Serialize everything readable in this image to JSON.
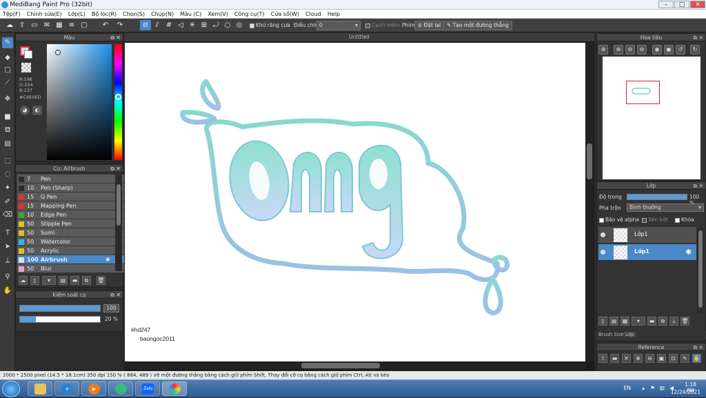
{
  "window": {
    "title": "MediBang Paint Pro (32bit)",
    "controls": [
      "–",
      "□",
      "✕"
    ]
  },
  "menu": [
    "Tệp(F)",
    "Chỉnh sửa(E)",
    "Lớp(L)",
    "Bộ lọc(R)",
    "Chọn(S)",
    "Chụp(N)",
    "Màu (C)",
    "Xem(V)",
    "Công cụ(T)",
    "Cửa sổ(W)",
    "Cloud",
    "Help"
  ],
  "toolbar": {
    "antialias_label": "Khử răng cưa",
    "adjust_label": "Điều chỉnh",
    "adjust_value": "0",
    "edge_label": "Cạnh mềm",
    "key_label": "Phím",
    "reset_label": "Đặt lại",
    "straight_line_label": "Tạo một đường thẳng"
  },
  "color_panel": {
    "title": "Màu",
    "r": "R:196",
    "g": "G:224",
    "b": "B:237",
    "hex": "#C4E0ED",
    "primary_color": "#C4E0ED"
  },
  "brush_panel": {
    "title": "Cọ: Airbrush",
    "brushes": [
      {
        "size": "7",
        "name": "Pen",
        "color": "#2a2a2a"
      },
      {
        "size": "10",
        "name": "Pen (Sharp)",
        "color": "#2a2a2a"
      },
      {
        "size": "15",
        "name": "G Pen",
        "color": "#e03030"
      },
      {
        "size": "15",
        "name": "Mapping Pen",
        "color": "#e03030"
      },
      {
        "size": "10",
        "name": "Edge Pen",
        "color": "#33aa33"
      },
      {
        "size": "50",
        "name": "Stipple Pen",
        "color": "#e0c020"
      },
      {
        "size": "50",
        "name": "Sumi",
        "color": "#e0c020"
      },
      {
        "size": "50",
        "name": "Watercolor",
        "color": "#30b8e8"
      },
      {
        "size": "50",
        "name": "Acrylic",
        "color": "#e0c020"
      },
      {
        "size": "100",
        "name": "Airbrush",
        "color": "#e0e0e0"
      },
      {
        "size": "50",
        "name": "Blur",
        "color": "#f0a0d0"
      }
    ],
    "selected_index": 9
  },
  "brush_control": {
    "title": "Kiểm soát cọ",
    "size_value": "100",
    "opacity_value": "20 %",
    "size_fraction": 1.0,
    "opacity_fraction": 0.2
  },
  "canvas": {
    "tab_title": "Untitled",
    "signature_line1": "#hd247",
    "signature_line2": "baongoc2011",
    "artwork_text": "omg"
  },
  "navigator": {
    "title": "Hoa tiêu"
  },
  "layer_panel": {
    "title": "Lớp",
    "opacity_label": "Độ trong",
    "opacity_value": "100 %",
    "opacity_fraction": 1.0,
    "blend_label": "Pha trộn",
    "blend_value": "Bình thường",
    "protect_alpha": "Bảo vệ alpha",
    "clipping": "Xén bớt",
    "lock": "Khóa",
    "layers": [
      {
        "name": "Lớp1"
      },
      {
        "name": "Lớp1"
      }
    ]
  },
  "bottom_tabs": [
    "Brush Size",
    "Lớp"
  ],
  "reference_panel": {
    "title": "Reference"
  },
  "status": "2000 * 2500 pixel   (14.5 * 18.1cm)   350 dpi   150 %   ( 884, 489 )   Vẽ một đường thẳng bằng cách giữ phím Shift, Thay đổi cỡ cọ bằng cách giữ phím Ctrl, Alt và kéo",
  "taskbar": {
    "apps": [
      "Explorer",
      "Internet Explorer",
      "Media Player",
      "Chrome-like",
      "Zalo",
      "Paint"
    ],
    "zalo_label": "Zalo",
    "lang": "EN",
    "time": "1:18 PM",
    "date": "12/24/2021"
  }
}
